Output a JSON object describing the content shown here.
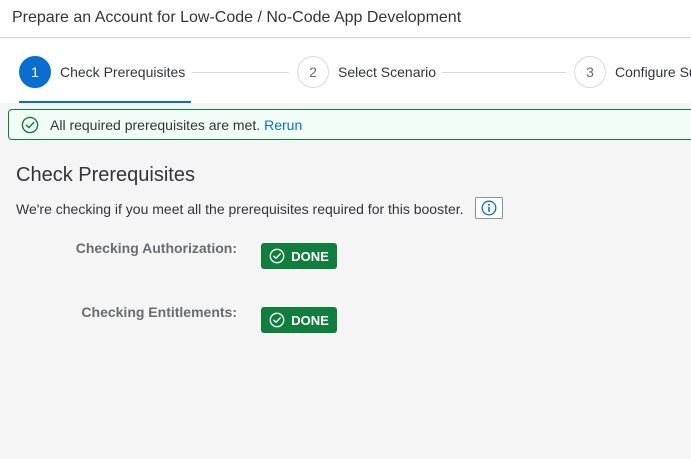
{
  "header": {
    "title": "Prepare an Account for Low-Code / No-Code App Development"
  },
  "wizard": {
    "steps": [
      {
        "number": "1",
        "label": "Check Prerequisites",
        "state": "active"
      },
      {
        "number": "2",
        "label": "Select Scenario",
        "state": "inactive"
      },
      {
        "number": "3",
        "label": "Configure Su",
        "state": "inactive"
      }
    ]
  },
  "message_strip": {
    "text": "All required prerequisites are met.",
    "link": "Rerun",
    "icon": "success-check-icon",
    "color": "#107e3e"
  },
  "section": {
    "title": "Check Prerequisites",
    "description": "We're checking if you meet all the prerequisites required for this booster.",
    "info_icon": "info-icon"
  },
  "checks": [
    {
      "label": "Checking Authorization:",
      "status": "DONE"
    },
    {
      "label": "Checking Entitlements:",
      "status": "DONE"
    }
  ],
  "colors": {
    "accent": "#0a6ed1",
    "success": "#107e3e"
  }
}
